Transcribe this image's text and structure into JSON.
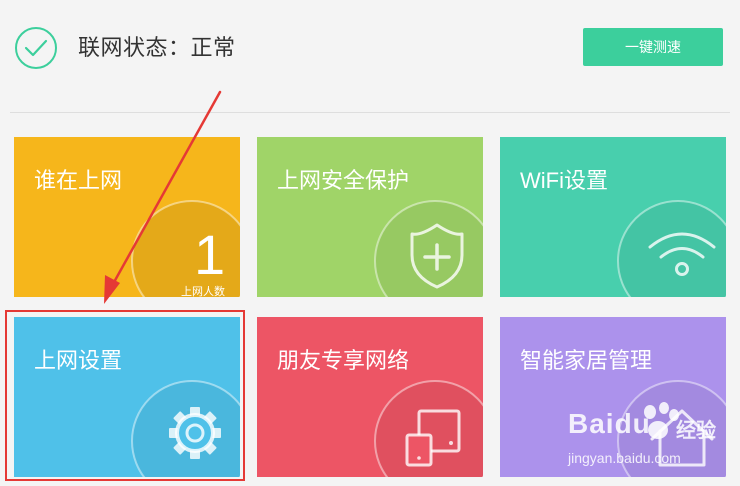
{
  "status": {
    "icon": "checkmark-circle-icon",
    "label": "联网状态：正常",
    "speed_test_button": "一键测速"
  },
  "tiles": [
    {
      "title": "谁在上网",
      "icon": "person-count",
      "count": "1",
      "count_label": "上网人数",
      "color": "#f6b61b"
    },
    {
      "title": "上网安全保护",
      "icon": "shield-plus-icon",
      "color": "#a0d468"
    },
    {
      "title": "WiFi设置",
      "icon": "wifi-icon",
      "color": "#48cfad"
    },
    {
      "title": "上网设置",
      "icon": "gear-icon",
      "color": "#4fc1e9"
    },
    {
      "title": "朋友专享网络",
      "icon": "devices-icon",
      "color": "#ed5565"
    },
    {
      "title": "智能家居管理",
      "icon": "home-icon",
      "color": "#ac92ec"
    }
  ],
  "colors": {
    "accent": "#3ccf9c",
    "annotation": "#e53935"
  },
  "watermark": {
    "logo": "Baidu",
    "suffix": "经验",
    "url": "jingyan.baidu.com"
  }
}
